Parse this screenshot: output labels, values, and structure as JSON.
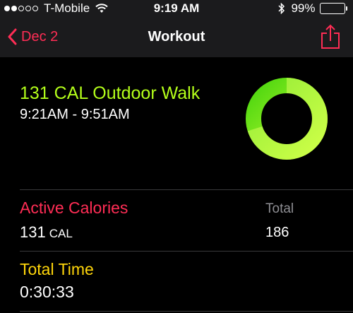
{
  "status_bar": {
    "carrier": "T-Mobile",
    "time": "9:19 AM",
    "battery_percent": "99%",
    "signal_bars_filled": 2,
    "signal_bars_total": 5
  },
  "nav": {
    "back_label": "Dec 2",
    "title": "Workout",
    "accent_color": "#ff2d55",
    "back_icon": "chevron-left-icon",
    "share_icon": "share-icon"
  },
  "workout": {
    "title": "131 CAL Outdoor Walk",
    "time_range": "9:21AM - 9:51AM",
    "title_color": "#b4ff1a",
    "ring_progress": 0.7
  },
  "metrics": {
    "active_calories": {
      "label": "Active Calories",
      "value": "131",
      "unit": "CAL",
      "color": "#ff2d55",
      "total_label": "Total",
      "total_value": "186"
    },
    "total_time": {
      "label": "Total Time",
      "value": "0:30:33",
      "color": "#ffd60a"
    }
  }
}
